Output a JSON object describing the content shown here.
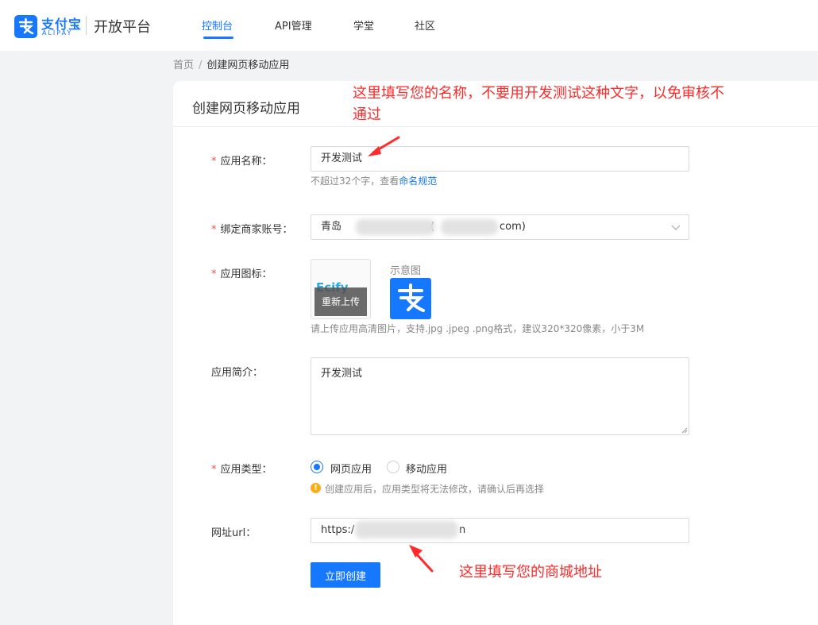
{
  "header": {
    "logo_cn": "支付宝",
    "logo_en": "ALIPAY",
    "platform": "开放平台",
    "nav": [
      {
        "label": "控制台",
        "active": true
      },
      {
        "label": "API管理",
        "active": false
      },
      {
        "label": "学堂",
        "active": false
      },
      {
        "label": "社区",
        "active": false
      }
    ],
    "brand_color": "#1677ff"
  },
  "breadcrumb": {
    "home": "首页",
    "separator": "/",
    "current": "创建网页移动应用"
  },
  "card": {
    "title": "创建网页移动应用"
  },
  "form": {
    "app_name": {
      "label": "应用名称：",
      "value": "开发测试",
      "hint_prefix": "不超过32个字，查看",
      "hint_link": "命名规范"
    },
    "merchant": {
      "label": "绑定商家账号：",
      "value_prefix": "青岛",
      "value_mid": "(",
      "value_suffix": "com)"
    },
    "icon": {
      "label": "应用图标：",
      "uploaded_text": "Ecify",
      "reupload": "重新上传",
      "example_label": "示意图",
      "hint": "请上传应用高清图片，支持.jpg .jpeg .png格式，建议320*320像素，小于3M"
    },
    "intro": {
      "label": "应用简介：",
      "value": "开发测试"
    },
    "type": {
      "label": "应用类型：",
      "options": [
        "网页应用",
        "移动应用"
      ],
      "selected": "网页应用",
      "warning": "创建应用后，应用类型将无法修改，请确认后再选择"
    },
    "url": {
      "label": "网址url：",
      "value_prefix": "https:/",
      "value_suffix": "n"
    },
    "submit": "立即创建"
  },
  "annotations": {
    "name_line1": "这里填写您的名称，不要用开发测试这种文字，以免审核不",
    "name_line2": "通过",
    "url": "这里填写您的商城地址",
    "color": "#ff2a2a"
  }
}
